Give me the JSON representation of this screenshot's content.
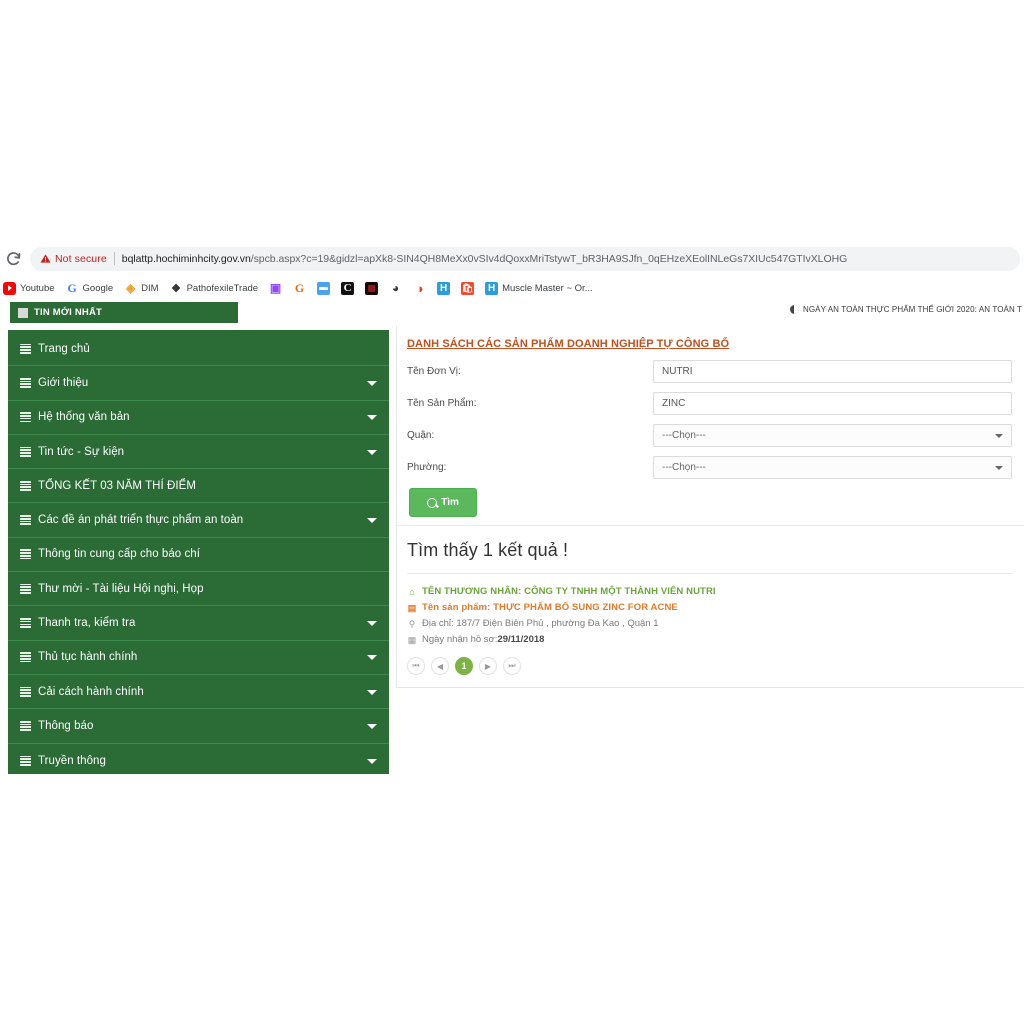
{
  "browser": {
    "reload_icon": "reload-icon",
    "security_warning_icon": "warning-triangle-icon",
    "security_label": "Not secure",
    "url_host": "bqlattp.hochiminhcity.gov.vn",
    "url_path": "/spcb.aspx?c=19&gidzl=apXk8-SIN4QH8MeXx0vSIv4dQoxxMriTstywT_bR3HA9SJfn_0qEHzeXEolINLeGs7XIUc547GTIvXLOHG",
    "bookmarks": [
      {
        "label": "Youtube",
        "icon": "youtube-icon"
      },
      {
        "label": "Google",
        "icon": "google-icon"
      },
      {
        "label": "DIM",
        "icon": "dim-icon"
      },
      {
        "label": "PathofexileTrade",
        "icon": "pathofexile-icon"
      },
      {
        "label": "",
        "icon": "twitch-icon"
      },
      {
        "label": "",
        "icon": "g2a-icon"
      },
      {
        "label": "",
        "icon": "blue-bar-icon"
      },
      {
        "label": "",
        "icon": "c-letter-icon"
      },
      {
        "label": "",
        "icon": "dark-red-icon"
      },
      {
        "label": "",
        "icon": "dark-circle-icon"
      },
      {
        "label": "",
        "icon": "opera-icon"
      },
      {
        "label": "",
        "icon": "h-letter-icon"
      },
      {
        "label": "",
        "icon": "shopee-icon"
      },
      {
        "label": "Muscle Master ~ Or...",
        "icon": "h-letter-icon"
      }
    ]
  },
  "site": {
    "news_tab_label": "TIN MỚI NHẤT",
    "marquee_text": "NGÀY AN TOÀN THỰC PHẨM THẾ GIỚI 2020: AN TOÀN T",
    "marquee_icon": "clock-icon"
  },
  "sidebar": {
    "items": [
      {
        "label": "Trang chủ",
        "has_caret": false
      },
      {
        "label": "Giới thiệu",
        "has_caret": true
      },
      {
        "label": "Hệ thống văn bản",
        "has_caret": true
      },
      {
        "label": "Tin tức - Sự kiện",
        "has_caret": true
      },
      {
        "label": "TỔNG KẾT 03 NĂM THÍ ĐIỂM",
        "has_caret": false
      },
      {
        "label": "Các đề án phát triển thực phẩm an toàn",
        "has_caret": true
      },
      {
        "label": "Thông tin cung cấp cho báo chí",
        "has_caret": false
      },
      {
        "label": "Thư mời - Tài liệu Hội nghị, Họp",
        "has_caret": false
      },
      {
        "label": "Thanh tra, kiểm tra",
        "has_caret": true
      },
      {
        "label": "Thủ tục hành chính",
        "has_caret": true
      },
      {
        "label": "Cải cách hành chính",
        "has_caret": true
      },
      {
        "label": "Thông báo",
        "has_caret": true
      },
      {
        "label": "Truyền thông",
        "has_caret": true
      }
    ]
  },
  "main": {
    "panel_title": "DANH SÁCH CÁC SẢN PHẨM DOANH NGHIỆP TỰ CÔNG BỐ",
    "form": {
      "fields": [
        {
          "label": "Tên Đơn Vị:",
          "value": "NUTRI",
          "type": "text"
        },
        {
          "label": "Tên Sản Phẩm:",
          "value": "ZINC",
          "type": "text"
        },
        {
          "label": "Quận:",
          "value": "---Chọn---",
          "type": "select"
        },
        {
          "label": "Phường:",
          "value": "---Chọn---",
          "type": "select"
        }
      ],
      "search_button": "Tìm",
      "search_icon": "magnifier-icon"
    },
    "results": {
      "heading": "Tìm thấy 1 kết quả !",
      "items": [
        {
          "merchant_icon": "home-icon",
          "merchant": "TÊN THƯƠNG NHÂN: CÔNG TY TNHH MỘT THÀNH VIÊN NUTRI",
          "product_icon": "list-icon",
          "product": "Tên sản phẩm: THỰC PHẨM BỔ SUNG ZINC FOR ACNE",
          "address_icon": "location-pin-icon",
          "address": "Địa chỉ: 187/7 Điện Biên Phủ , phường Đa Kao , Quận 1",
          "date_icon": "calendar-icon",
          "date_label": "Ngày nhận hồ sơ: ",
          "date_value": "29/11/2018"
        }
      ],
      "pagination": {
        "first": "⏮",
        "prev": "◀",
        "current": "1",
        "next": "▶",
        "last": "⏭"
      }
    }
  },
  "colors": {
    "sidebar_green": "#2a6b36",
    "button_green": "#5cb85c",
    "pager_active_green": "#7cb342",
    "title_orange": "#c0501f",
    "merchant_green": "#6ba539",
    "product_orange": "#e07b2a",
    "not_secure_red": "#c5221f"
  }
}
